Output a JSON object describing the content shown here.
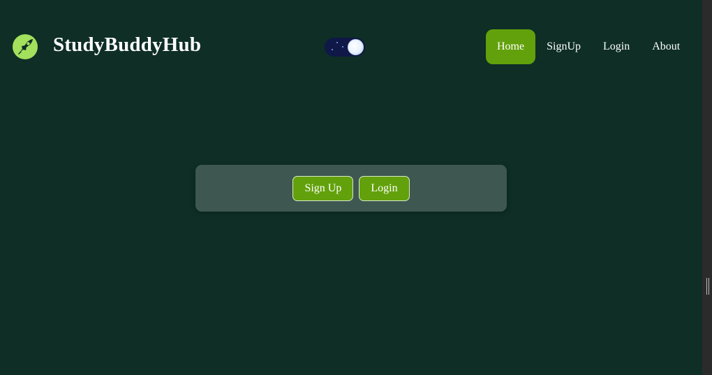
{
  "brand": {
    "name": "StudyBuddyHub",
    "logo_icon": "rocket-icon",
    "logo_color": "#a3e05c"
  },
  "theme_toggle": {
    "mode": "dark",
    "icon": "moon-icon"
  },
  "nav": {
    "items": [
      {
        "label": "Home",
        "active": true
      },
      {
        "label": "SignUp",
        "active": false
      },
      {
        "label": "Login",
        "active": false
      },
      {
        "label": "About",
        "active": false
      }
    ]
  },
  "panel": {
    "signup_label": "Sign Up",
    "login_label": "Login"
  },
  "colors": {
    "background": "#0e2e26",
    "accent": "#62a10b",
    "panel": "#3e5750"
  }
}
